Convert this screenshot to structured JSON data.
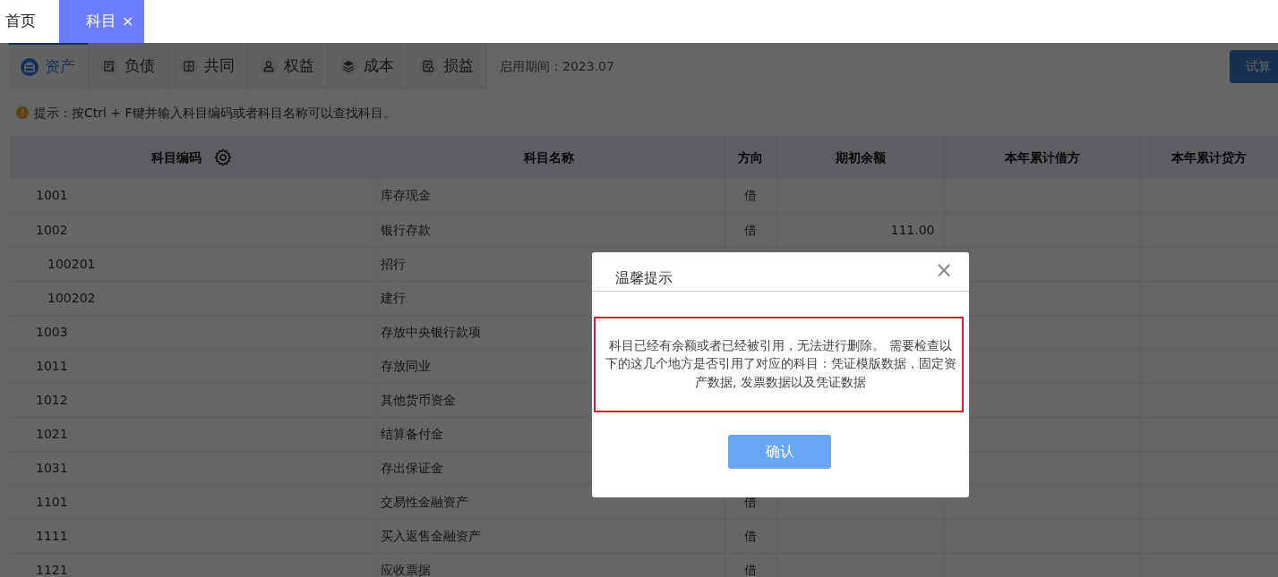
{
  "tabs": [
    {
      "label": "首页",
      "selected": false
    },
    {
      "label": "科目",
      "selected": true,
      "close": "×"
    }
  ],
  "category_tabs": [
    {
      "label": "资产",
      "selected": true
    },
    {
      "label": "负债",
      "selected": false
    },
    {
      "label": "共同",
      "selected": false
    },
    {
      "label": "权益",
      "selected": false
    },
    {
      "label": "成本",
      "selected": false
    },
    {
      "label": "损益",
      "selected": false
    }
  ],
  "period": "启用期间：2023.07",
  "action_button": "试算",
  "hint": "提示：按Ctrl + F键并输入科目编码或者科目名称可以查找科目。",
  "table": {
    "columns": [
      "科目编码",
      "科目名称",
      "方向",
      "期初余额",
      "本年累计借方",
      "本年累计贷方"
    ],
    "rows": [
      {
        "code": "1001",
        "name": "库存现金",
        "direction": "借"
      },
      {
        "code": "1002",
        "name": "银行存款",
        "direction": "借",
        "opening_balance": "111.00",
        "children": [
          {
            "code": "100201",
            "name": "招行"
          },
          {
            "code": "100202",
            "name": "建行"
          }
        ]
      },
      {
        "code": "1003",
        "name": "存放中央银行款项"
      },
      {
        "code": "1011",
        "name": "存放同业"
      },
      {
        "code": "1012",
        "name": "其他货币资金"
      },
      {
        "code": "1021",
        "name": "结算备付金"
      },
      {
        "code": "1031",
        "name": "存出保证金"
      },
      {
        "code": "1101",
        "name": "交易性金融资产",
        "direction": "借"
      },
      {
        "code": "1111",
        "name": "买入返售金融资产",
        "direction": "借"
      },
      {
        "code": "1121",
        "name": "应收票据",
        "direction": "借"
      }
    ]
  },
  "dialog": {
    "title": "温馨提示",
    "close": "×",
    "message": "科目已经有余额或者已经被引用，无法进行删除。 需要检查以下的这几个地方是否引用了对应的科目：凭证模版数据，固定资产数据, 发票数据以及凭证数据",
    "confirm": "确认"
  }
}
